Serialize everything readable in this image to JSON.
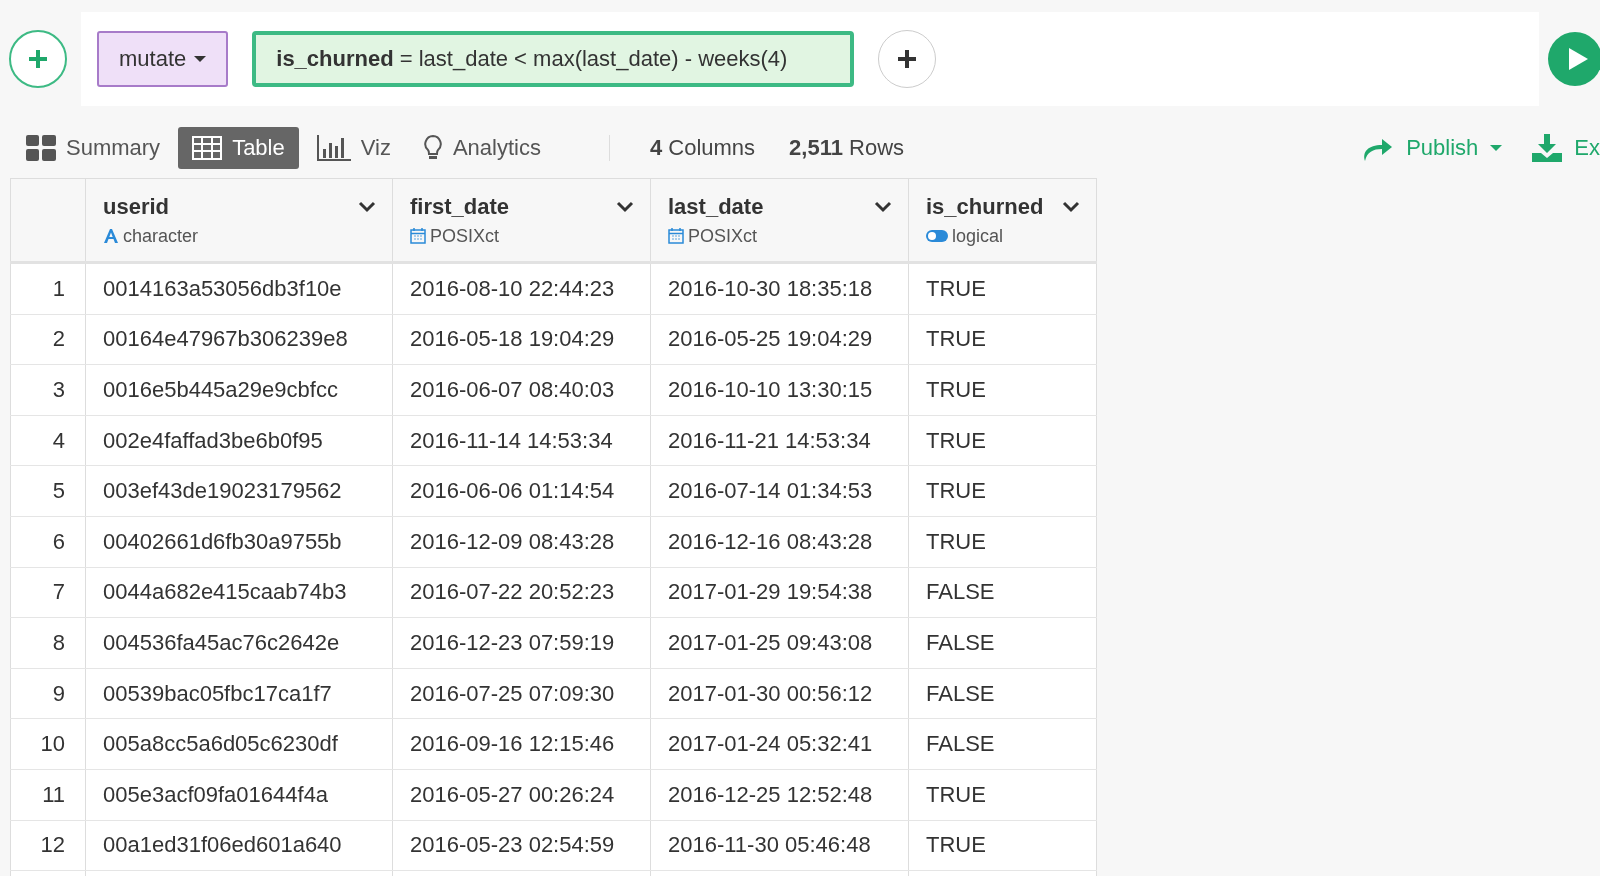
{
  "step": {
    "command": "mutate",
    "formula_name": "is_churned",
    "formula_rest": "= last_date < max(last_date) - weeks(4)"
  },
  "tabs": [
    {
      "label": "Summary",
      "kind": "summary",
      "selected": false
    },
    {
      "label": "Table",
      "kind": "table",
      "selected": true
    },
    {
      "label": "Viz",
      "kind": "viz",
      "selected": false
    },
    {
      "label": "Analytics",
      "kind": "analytics",
      "selected": false
    }
  ],
  "counts": {
    "columns_number": "4",
    "columns_label": "Columns",
    "rows_number": "2,511",
    "rows_label": "Rows"
  },
  "actions": {
    "publish": "Publish",
    "export": "Ex"
  },
  "table": {
    "columns": [
      {
        "name": "userid",
        "type": "character",
        "kind": "character"
      },
      {
        "name": "first_date",
        "type": "POSIXct",
        "kind": "date"
      },
      {
        "name": "last_date",
        "type": "POSIXct",
        "kind": "date"
      },
      {
        "name": "is_churned",
        "type": "logical",
        "kind": "logical"
      }
    ],
    "rows": [
      {
        "index": "1",
        "cells": [
          "0014163a53056db3f10e",
          "2016-08-10 22:44:23",
          "2016-10-30 18:35:18",
          "TRUE"
        ]
      },
      {
        "index": "2",
        "cells": [
          "00164e47967b306239e8",
          "2016-05-18 19:04:29",
          "2016-05-25 19:04:29",
          "TRUE"
        ]
      },
      {
        "index": "3",
        "cells": [
          "0016e5b445a29e9cbfcc",
          "2016-06-07 08:40:03",
          "2016-10-10 13:30:15",
          "TRUE"
        ]
      },
      {
        "index": "4",
        "cells": [
          "002e4faffad3be6b0f95",
          "2016-11-14 14:53:34",
          "2016-11-21 14:53:34",
          "TRUE"
        ]
      },
      {
        "index": "5",
        "cells": [
          "003ef43de19023179562",
          "2016-06-06 01:14:54",
          "2016-07-14 01:34:53",
          "TRUE"
        ]
      },
      {
        "index": "6",
        "cells": [
          "00402661d6fb30a9755b",
          "2016-12-09 08:43:28",
          "2016-12-16 08:43:28",
          "TRUE"
        ]
      },
      {
        "index": "7",
        "cells": [
          "0044a682e415caab74b3",
          "2016-07-22 20:52:23",
          "2017-01-29 19:54:38",
          "FALSE"
        ]
      },
      {
        "index": "8",
        "cells": [
          "004536fa45ac76c2642e",
          "2016-12-23 07:59:19",
          "2017-01-25 09:43:08",
          "FALSE"
        ]
      },
      {
        "index": "9",
        "cells": [
          "00539bac05fbc17ca1f7",
          "2016-07-25 07:09:30",
          "2017-01-30 00:56:12",
          "FALSE"
        ]
      },
      {
        "index": "10",
        "cells": [
          "005a8cc5a6d05c6230df",
          "2016-09-16 12:15:46",
          "2017-01-24 05:32:41",
          "FALSE"
        ]
      },
      {
        "index": "11",
        "cells": [
          "005e3acf09fa01644f4a",
          "2016-05-27 00:26:24",
          "2016-12-25 12:52:48",
          "TRUE"
        ]
      },
      {
        "index": "12",
        "cells": [
          "00a1ed31f06ed601a640",
          "2016-05-23 02:54:59",
          "2016-11-30 05:46:48",
          "TRUE"
        ]
      }
    ]
  }
}
